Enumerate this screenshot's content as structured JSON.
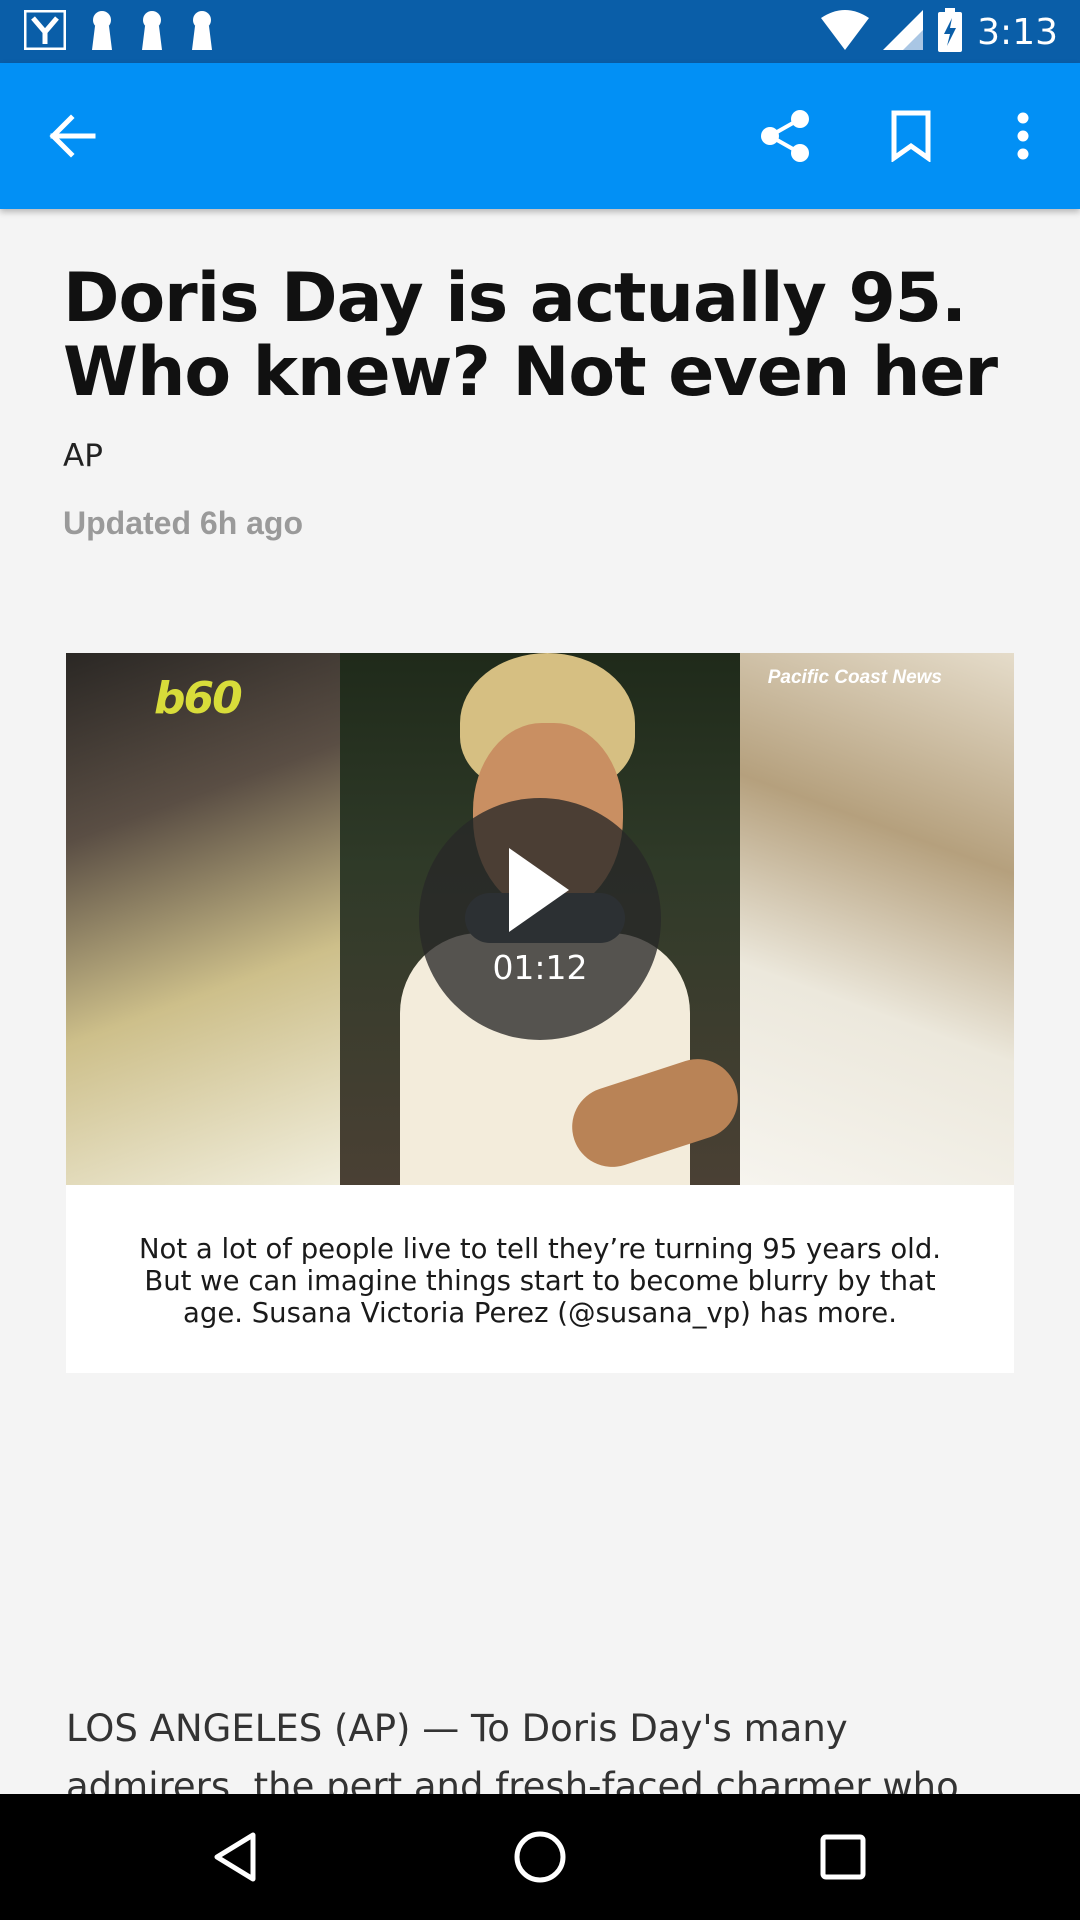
{
  "status_bar": {
    "time": "3:13",
    "left_icons": [
      "yahoo-notification-icon",
      "keyhole-icon",
      "keyhole-icon",
      "keyhole-icon"
    ],
    "right_icons": [
      "wifi-icon",
      "signal-icon",
      "battery-charging-icon"
    ]
  },
  "app_bar": {
    "background": "#0290f5",
    "actions": [
      "back-arrow-icon",
      "share-icon",
      "bookmark-icon",
      "more-vert-icon"
    ]
  },
  "article": {
    "headline": "Doris Day is actually 95. Who knew? Not even her",
    "source": "AP",
    "updated": "Updated 6h ago",
    "video": {
      "logo": "b60",
      "watermark": "Pacific Coast News",
      "duration": "01:12",
      "caption": "Not a lot of people live to tell they’re turning 95 years old. But we can imagine things start to become blurry by that age. Susana Victoria Perez (@susana_vp) has more."
    },
    "body_preview": "LOS ANGELES (AP) — To Doris Day's many admirers, the pert and fresh-faced charmer who"
  },
  "nav_bar": {
    "buttons": [
      "back-triangle-icon",
      "home-circle-icon",
      "recents-square-icon"
    ]
  }
}
